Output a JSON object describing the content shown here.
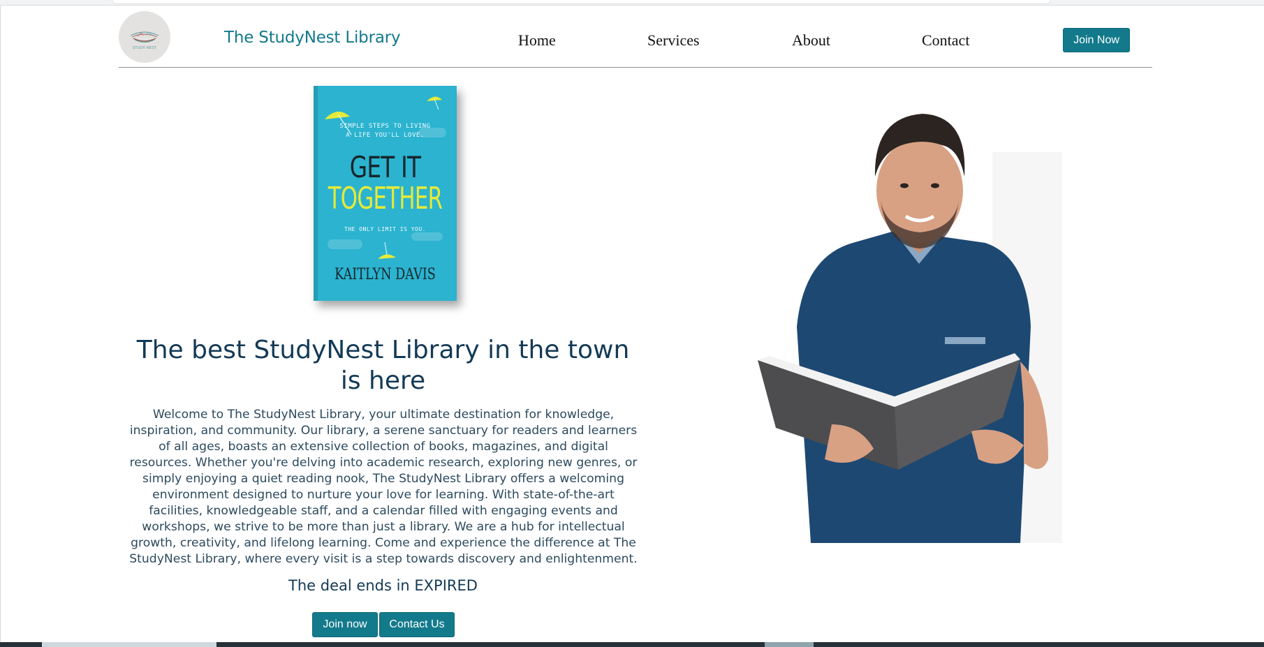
{
  "header": {
    "brand": "The StudyNest Library",
    "logo_text": "STUDY NEST",
    "nav": [
      "Home",
      "Services",
      "About",
      "Contact"
    ],
    "join_button": "Join Now"
  },
  "book": {
    "tagline_1": "SIMPLE STEPS TO LIVING",
    "tagline_2": "A LIFE YOU'LL LOVE.",
    "title_1": "GET IT",
    "title_2": "TOGETHER",
    "subtitle": "THE ONLY LIMIT IS YOU.",
    "author": "KAITLYN DAVIS"
  },
  "hero": {
    "headline": "The best StudyNest Library in the town is here",
    "body": "Welcome to The StudyNest Library, your ultimate destination for knowledge, inspiration, and community. Our library, a serene sanctuary for readers and learners of all ages, boasts an extensive collection of books, magazines, and digital resources. Whether you're delving into academic research, exploring new genres, or simply enjoying a quiet reading nook, The StudyNest Library offers a welcoming environment designed to nurture your love for learning. With state-of-the-art facilities, knowledgeable staff, and a calendar filled with engaging events and workshops, we strive to be more than just a library. We are a hub for intellectual growth, creativity, and lifelong learning. Come and experience the difference at The StudyNest Library, where every visit is a step towards discovery and enlightenment.",
    "deal": "The deal ends in EXPIRED",
    "join_button": "Join now",
    "contact_button": "Contact Us"
  },
  "colors": {
    "accent": "#137a8c",
    "heading": "#133a55",
    "body_text": "#2c4a5e"
  }
}
